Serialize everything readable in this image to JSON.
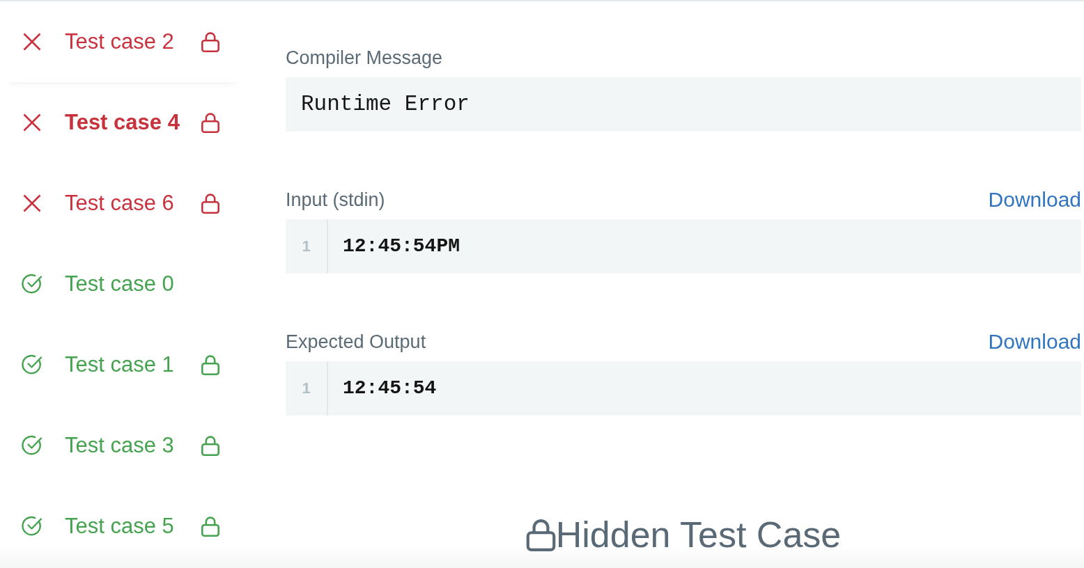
{
  "test_cases": [
    {
      "label": "Test case 2",
      "kind": "failed",
      "locked": true,
      "selected": false
    },
    {
      "label": "Test case 4",
      "kind": "failed",
      "locked": true,
      "selected": true
    },
    {
      "label": "Test case 6",
      "kind": "failed",
      "locked": true,
      "selected": false
    },
    {
      "label": "Test case 0",
      "kind": "passed",
      "locked": false,
      "selected": false
    },
    {
      "label": "Test case 1",
      "kind": "passed",
      "locked": true,
      "selected": false
    },
    {
      "label": "Test case 3",
      "kind": "passed",
      "locked": true,
      "selected": false
    },
    {
      "label": "Test case 5",
      "kind": "passed",
      "locked": true,
      "selected": false
    }
  ],
  "sections": [
    {
      "kind": "message",
      "title": "Compiler Message",
      "text": "Runtime Error"
    },
    {
      "kind": "code",
      "title": "Input (stdin)",
      "action": "Download",
      "lines": [
        {
          "number": "1",
          "text": "12:45:54PM"
        }
      ]
    },
    {
      "kind": "code",
      "title": "Expected Output",
      "action": "Download",
      "lines": [
        {
          "number": "1",
          "text": "12:45:54"
        }
      ]
    }
  ],
  "hidden_notice": {
    "text": "Hidden Test Case"
  }
}
